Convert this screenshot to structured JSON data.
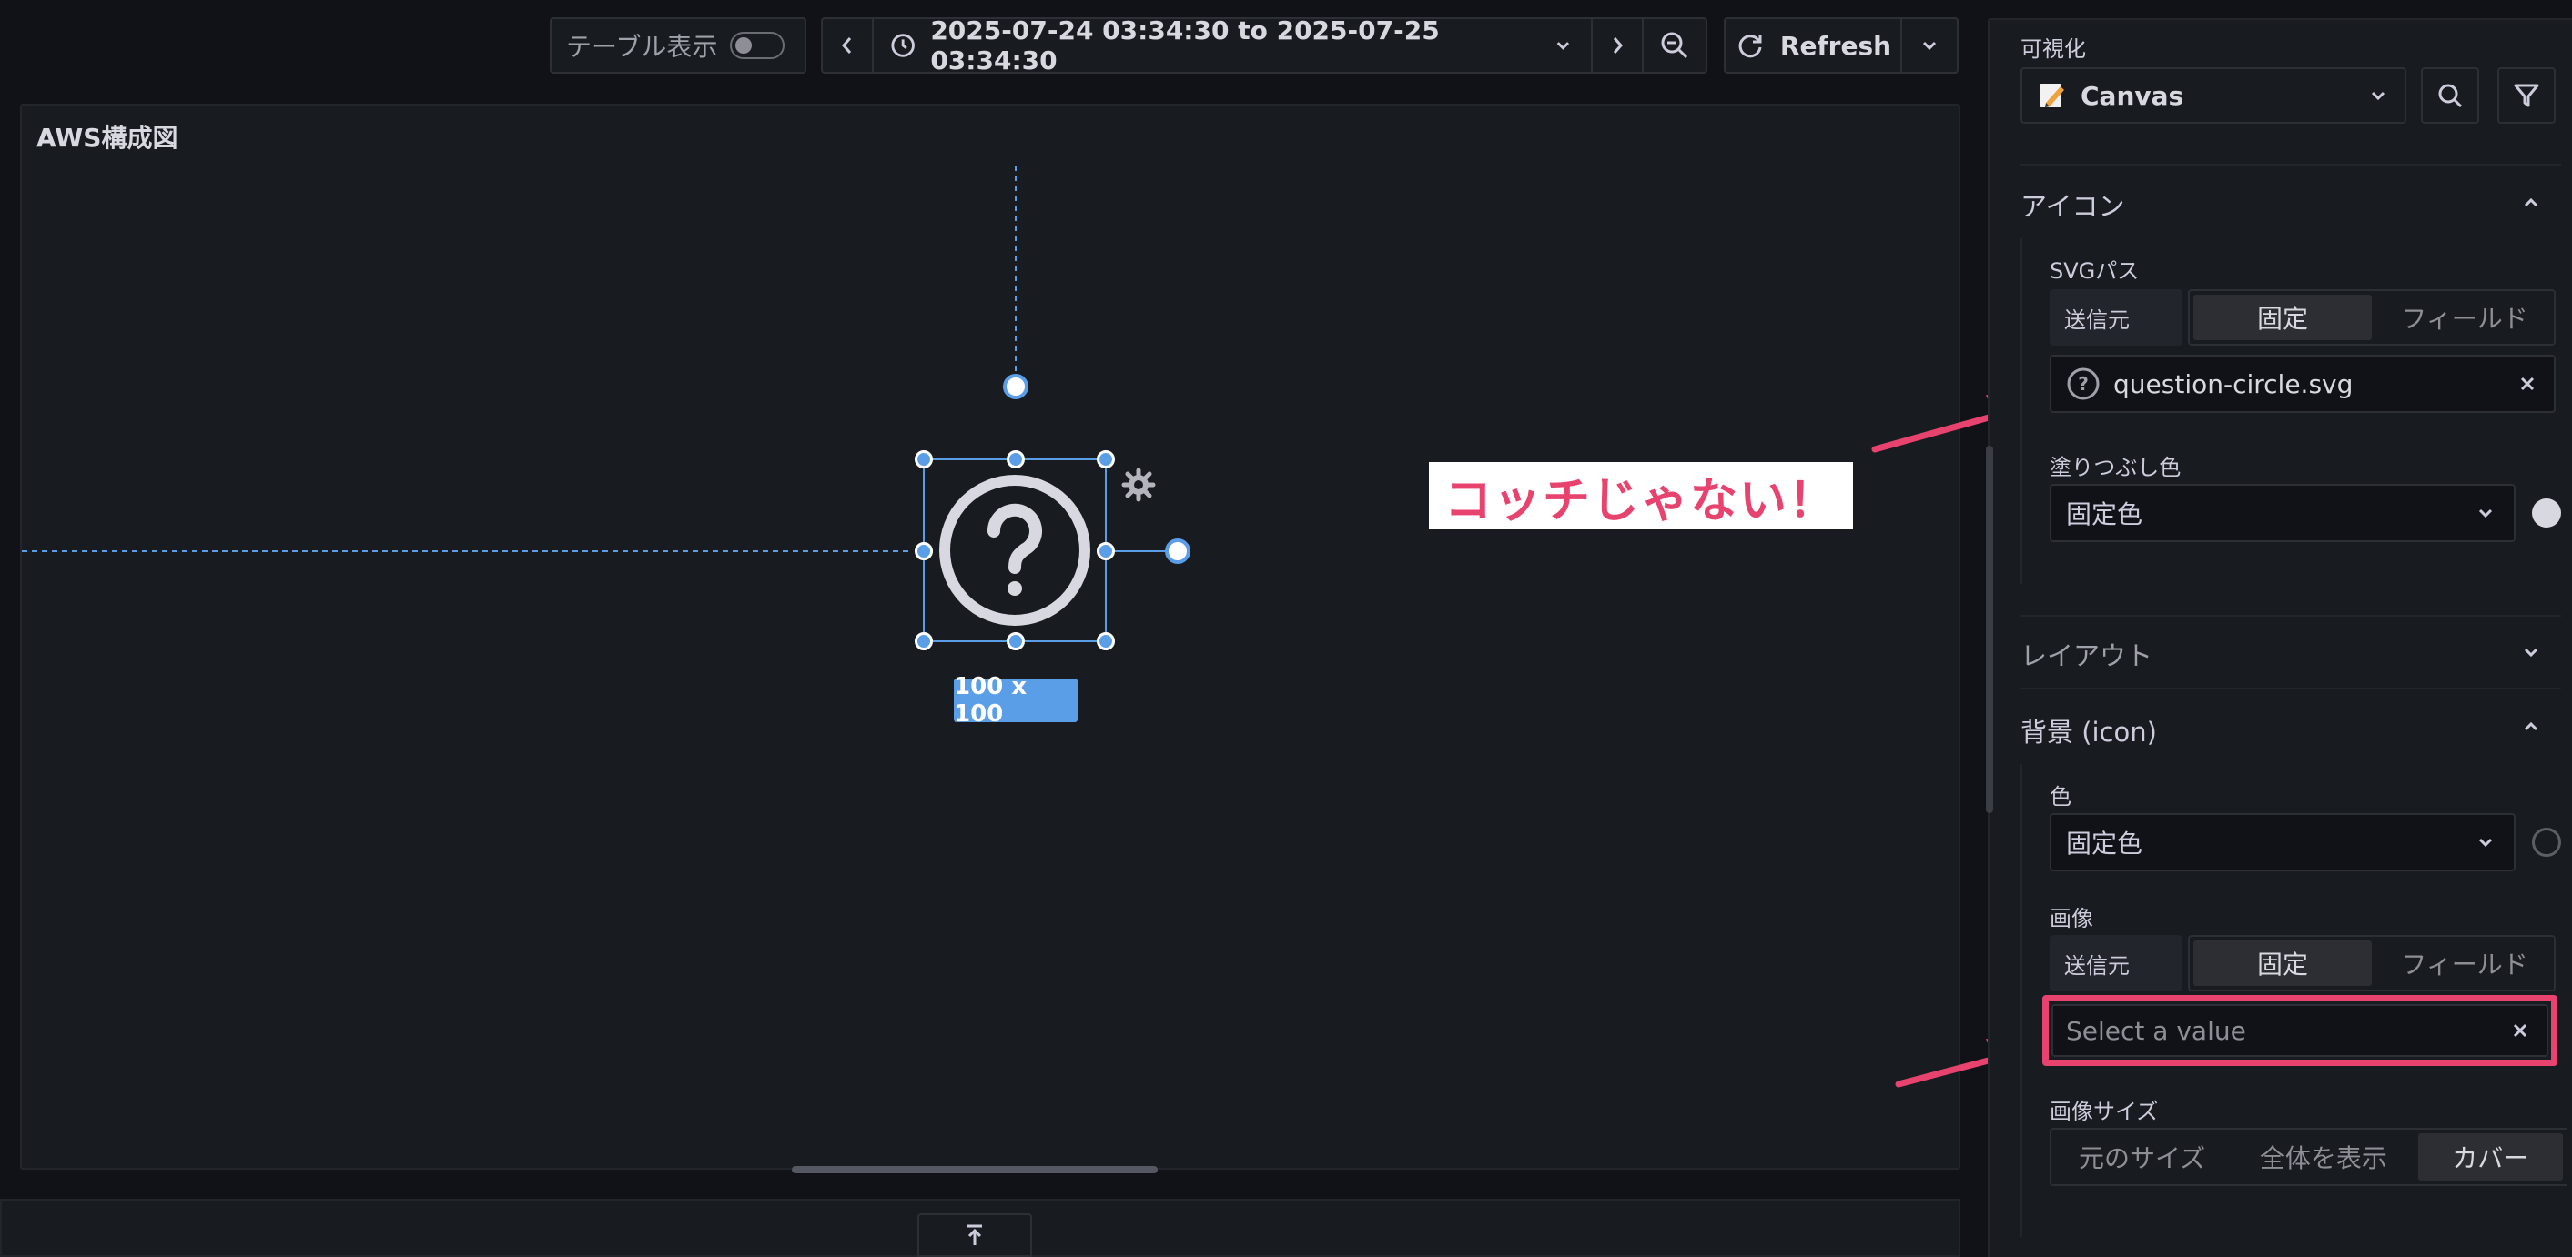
{
  "toolbar": {
    "table_view_label": "テーブル表示",
    "time_range": "2025-07-24 03:34:30 to 2025-07-25 03:34:30",
    "refresh_label": "Refresh"
  },
  "panel": {
    "title": "AWS構成図",
    "element_size_label": "100 x 100"
  },
  "annotation": {
    "callout_text": "コッチじゃない！"
  },
  "sidebar": {
    "visualization_label": "可視化",
    "visualization_value": "Canvas",
    "icon_section": {
      "title": "アイコン",
      "svg_path_label": "SVGパス",
      "source_label": "送信元",
      "mode_fixed": "固定",
      "mode_field": "フィールド",
      "svg_value": "question-circle.svg",
      "fill_color_label": "塗りつぶし色",
      "fill_color_value": "固定色"
    },
    "layout_section": {
      "title": "レイアウト"
    },
    "background_section": {
      "title": "背景 (icon)",
      "color_label": "色",
      "color_value": "固定色",
      "image_label": "画像",
      "source_label": "送信元",
      "mode_fixed": "固定",
      "mode_field": "フィールド",
      "image_placeholder": "Select a value",
      "image_size_label": "画像サイズ",
      "size_original": "元のサイズ",
      "size_contain": "全体を表示",
      "size_cover": "カバー"
    }
  },
  "colors": {
    "accent_blue": "#5b9ee8",
    "highlight_pink": "#e8436f",
    "background": "#111217"
  }
}
